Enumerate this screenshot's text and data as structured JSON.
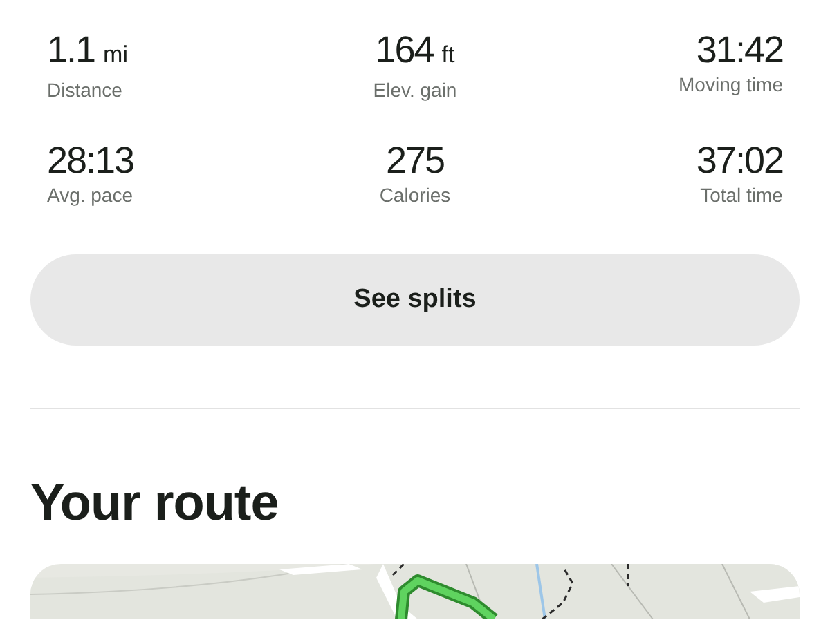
{
  "stats": [
    {
      "value": "1.1",
      "unit": "mi",
      "label": "Distance"
    },
    {
      "value": "164",
      "unit": "ft",
      "label": "Elev. gain"
    },
    {
      "value": "31:42",
      "label": "Moving time"
    },
    {
      "value": "28:13",
      "label": "Avg. pace"
    },
    {
      "value": "275",
      "label": "Calories"
    },
    {
      "value": "37:02",
      "label": "Total time"
    }
  ],
  "splits_button": "See splits",
  "route": {
    "title": "Your route"
  }
}
